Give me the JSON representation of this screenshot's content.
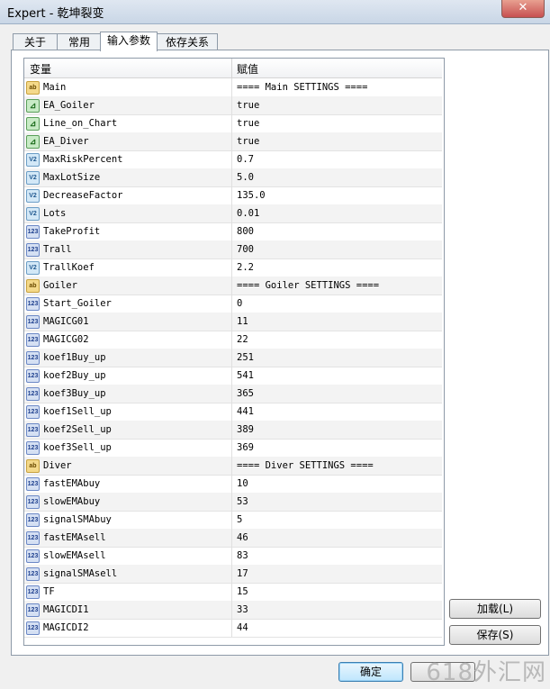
{
  "window": {
    "title": "Expert - 乾坤裂变",
    "close_label": "✕"
  },
  "tabs": [
    {
      "label": "关于"
    },
    {
      "label": "常用"
    },
    {
      "label": "输入参数"
    },
    {
      "label": "依存关系"
    }
  ],
  "grid": {
    "header": {
      "col1": "变量",
      "col2": "赋值"
    },
    "rows": [
      {
        "icon": "ab",
        "name": "Main",
        "value": "==== Main SETTINGS ===="
      },
      {
        "icon": "bool",
        "name": "EA_Goiler",
        "value": "true"
      },
      {
        "icon": "bool",
        "name": "Line_on_Chart",
        "value": "true"
      },
      {
        "icon": "bool",
        "name": "EA_Diver",
        "value": "true"
      },
      {
        "icon": "dbl",
        "name": "MaxRiskPercent",
        "value": "0.7"
      },
      {
        "icon": "dbl",
        "name": "MaxLotSize",
        "value": "5.0"
      },
      {
        "icon": "dbl",
        "name": "DecreaseFactor",
        "value": "135.0"
      },
      {
        "icon": "dbl",
        "name": "Lots",
        "value": "0.01"
      },
      {
        "icon": "int",
        "name": "TakeProfit",
        "value": "800"
      },
      {
        "icon": "int",
        "name": "Trall",
        "value": "700"
      },
      {
        "icon": "dbl",
        "name": "TrallKoef",
        "value": "2.2"
      },
      {
        "icon": "ab",
        "name": "Goiler",
        "value": "==== Goiler SETTINGS  ===="
      },
      {
        "icon": "int",
        "name": "Start_Goiler",
        "value": "0"
      },
      {
        "icon": "int",
        "name": "MAGICG01",
        "value": "11"
      },
      {
        "icon": "int",
        "name": "MAGICG02",
        "value": "22"
      },
      {
        "icon": "int",
        "name": "koef1Buy_up",
        "value": "251"
      },
      {
        "icon": "int",
        "name": "koef2Buy_up",
        "value": "541"
      },
      {
        "icon": "int",
        "name": "koef3Buy_up",
        "value": "365"
      },
      {
        "icon": "int",
        "name": "koef1Sell_up",
        "value": "441"
      },
      {
        "icon": "int",
        "name": "koef2Sell_up",
        "value": "389"
      },
      {
        "icon": "int",
        "name": "koef3Sell_up",
        "value": "369"
      },
      {
        "icon": "ab",
        "name": "Diver",
        "value": "==== Diver SETTINGS ===="
      },
      {
        "icon": "int",
        "name": "fastEMAbuy",
        "value": "10"
      },
      {
        "icon": "int",
        "name": "slowEMAbuy",
        "value": "53"
      },
      {
        "icon": "int",
        "name": "signalSMAbuy",
        "value": "5"
      },
      {
        "icon": "int",
        "name": "fastEMAsell",
        "value": "46"
      },
      {
        "icon": "int",
        "name": "slowEMAsell",
        "value": "83"
      },
      {
        "icon": "int",
        "name": "signalSMAsell",
        "value": "17"
      },
      {
        "icon": "int",
        "name": "TF",
        "value": "15"
      },
      {
        "icon": "int",
        "name": "MAGICDI1",
        "value": "33"
      },
      {
        "icon": "int",
        "name": "MAGICDI2",
        "value": "44"
      }
    ]
  },
  "icon_glyphs": {
    "ab": "ab",
    "bool": "⊿",
    "dbl": "V2",
    "int": "123"
  },
  "buttons": {
    "load": "加载(L)",
    "save": "保存(S)",
    "ok": "确定"
  },
  "watermark": "618外汇网"
}
